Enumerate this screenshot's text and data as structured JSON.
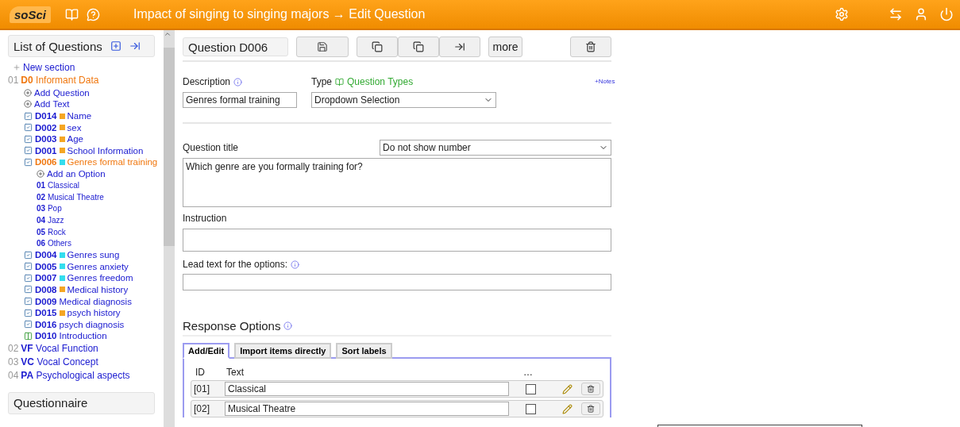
{
  "header": {
    "logo": "soSci",
    "title": "Impact of singing to singing majors → Edit Question"
  },
  "sidebar": {
    "title": "List of Questions",
    "new_section": "New section",
    "sections": [
      {
        "number": "01",
        "code": "D0",
        "title": "Informant Data",
        "selected": true,
        "children": [
          {
            "kind": "action",
            "title": "Add Question"
          },
          {
            "kind": "action",
            "title": "Add Text"
          },
          {
            "kind": "question",
            "code": "D014",
            "title": "Name",
            "color": "#f5a623",
            "selected": false
          },
          {
            "kind": "question",
            "code": "D002",
            "title": "sex",
            "color": "#f5a623",
            "selected": false
          },
          {
            "kind": "question",
            "code": "D003",
            "title": "Age",
            "color": "#f5a623",
            "selected": false
          },
          {
            "kind": "question",
            "code": "D001",
            "title": "School Information",
            "color": "#f5a623",
            "selected": false
          },
          {
            "kind": "question",
            "code": "D006",
            "title": "Genres formal training",
            "color": "#33ddee",
            "selected": true,
            "children": [
              {
                "kind": "action",
                "title": "Add an Option"
              },
              {
                "kind": "option",
                "code": "01",
                "title": "Classical"
              },
              {
                "kind": "option",
                "code": "02",
                "title": "Musical Theatre"
              },
              {
                "kind": "option",
                "code": "03",
                "title": "Pop"
              },
              {
                "kind": "option",
                "code": "04",
                "title": "Jazz"
              },
              {
                "kind": "option",
                "code": "05",
                "title": "Rock"
              },
              {
                "kind": "option",
                "code": "06",
                "title": "Others"
              }
            ]
          },
          {
            "kind": "question",
            "code": "D004",
            "title": "Genres sung",
            "color": "#33ddee",
            "selected": false
          },
          {
            "kind": "question",
            "code": "D005",
            "title": "Genres anxiety",
            "color": "#33ddee",
            "selected": false
          },
          {
            "kind": "question",
            "code": "D007",
            "title": "Genres freedom",
            "color": "#33ddee",
            "selected": false
          },
          {
            "kind": "question",
            "code": "D008",
            "title": "Medical history",
            "color": "#f5a623",
            "selected": false
          },
          {
            "kind": "question",
            "code": "D009",
            "title": "Medical diagnosis",
            "selected": false
          },
          {
            "kind": "question",
            "code": "D015",
            "title": "psych history",
            "color": "#f5a623",
            "selected": false
          },
          {
            "kind": "question",
            "code": "D016",
            "title": "psych diagnosis",
            "selected": false
          },
          {
            "kind": "text",
            "code": "D010",
            "title": "Introduction",
            "selected": false
          }
        ]
      },
      {
        "number": "02",
        "code": "VF",
        "title": "Vocal Function",
        "selected": false
      },
      {
        "number": "03",
        "code": "VC",
        "title": "Vocal Concept",
        "selected": false
      },
      {
        "number": "04",
        "code": "PA",
        "title": "Psychological aspects",
        "selected": false
      }
    ],
    "next_panel": "Questionnaire"
  },
  "editor": {
    "question_label": "Question D006",
    "more": "more",
    "description_label": "Description",
    "description_value": "Genres formal training",
    "type_label": "Type",
    "type_link": "Question Types",
    "type_value": "Dropdown Selection",
    "notes": "+Notes",
    "title_label": "Question title",
    "numbering": "Do not show number",
    "title_value": "Which genre are you formally training for?",
    "instruction_label": "Instruction",
    "lead_label": "Lead text for the options:",
    "response_heading": "Response Options",
    "tabs": [
      {
        "label": "Add/Edit",
        "selected": true
      },
      {
        "label": "Import items directly",
        "selected": false
      },
      {
        "label": "Sort labels",
        "selected": false
      }
    ],
    "columns": [
      "ID",
      "Text",
      "…"
    ],
    "options": [
      {
        "id": "[01]",
        "text": "Classical",
        "checked": false
      },
      {
        "id": "[02]",
        "text": "Musical Theatre",
        "checked": false
      }
    ]
  }
}
